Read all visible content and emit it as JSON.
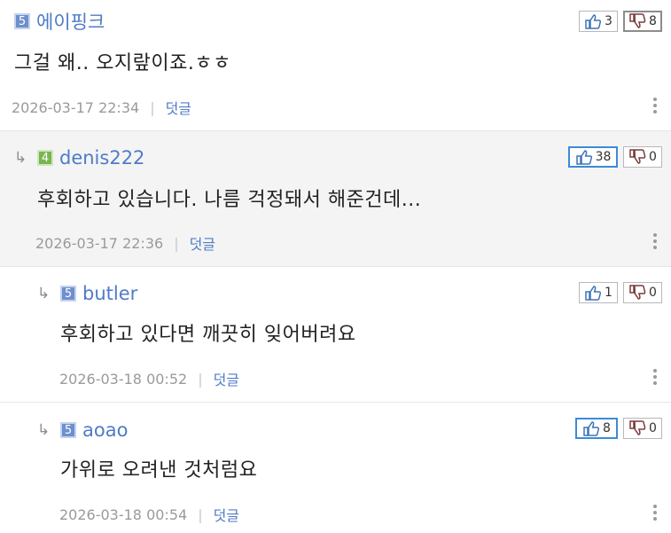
{
  "comments": [
    {
      "level": "5",
      "author": "에이핑크",
      "text": "그걸 왜.. 오지랖이죠.ㅎㅎ",
      "date": "2026-03-17 22:34",
      "reply": "덧글",
      "up": "3",
      "down": "8"
    },
    {
      "level": "4",
      "author": "denis222",
      "text": "후회하고 있습니다. 나름 걱정돼서 해준건데...",
      "date": "2026-03-17 22:36",
      "reply": "덧글",
      "up": "38",
      "down": "0"
    },
    {
      "level": "5",
      "author": "butler",
      "text": "후회하고 있다면 깨끗히 잊어버려요",
      "date": "2026-03-18 00:52",
      "reply": "덧글",
      "up": "1",
      "down": "0"
    },
    {
      "level": "5",
      "author": "aoao",
      "text": "가위로 오려낸 것처럼요",
      "date": "2026-03-18 00:54",
      "reply": "덧글",
      "up": "8",
      "down": "0"
    }
  ],
  "reply_arrow": "↳",
  "separator": "|",
  "icons": {
    "up": "thumbs-up-icon",
    "down": "thumbs-down-icon",
    "more": "more-vertical-icon",
    "reply": "reply-arrow-icon"
  },
  "colors": {
    "author": "#4f7bc8",
    "level5": "#6e8fce",
    "level4": "#79b552",
    "highlight_up": "#3b8bd8"
  }
}
